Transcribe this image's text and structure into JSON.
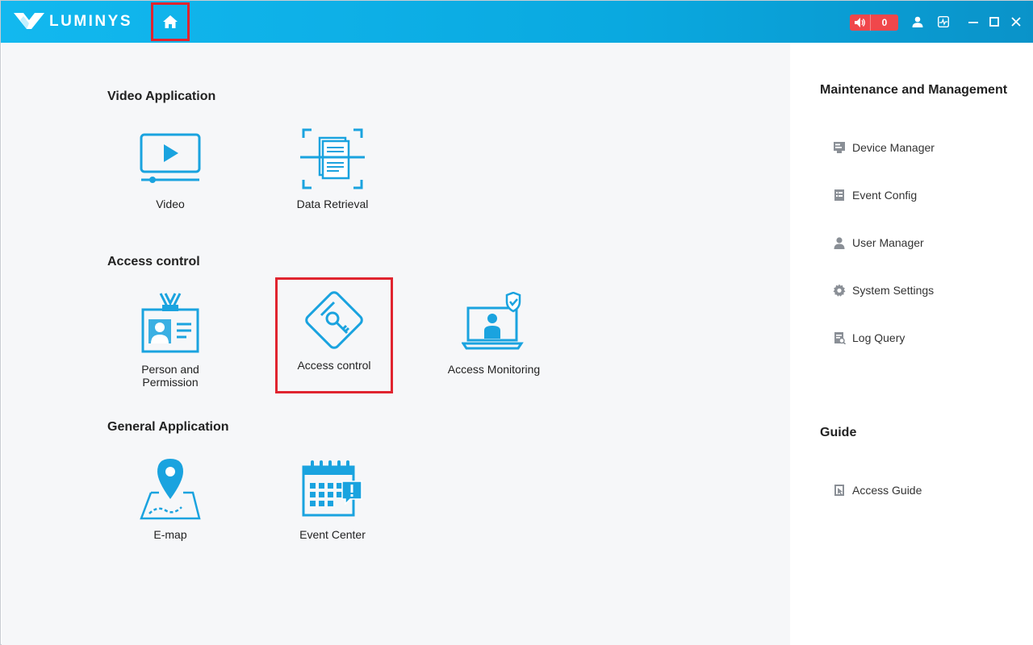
{
  "app": {
    "brand": "LUMINYS"
  },
  "titlebar": {
    "alarm_count": "0"
  },
  "sections": {
    "video_application": {
      "title": "Video Application",
      "items": [
        {
          "label": "Video",
          "icon": "video-player-icon"
        },
        {
          "label": "Data Retrieval",
          "icon": "document-scan-icon"
        }
      ]
    },
    "access_control": {
      "title": "Access control",
      "items": [
        {
          "label": "Person and Permission",
          "icon": "id-badge-icon"
        },
        {
          "label": "Access control",
          "icon": "key-card-icon"
        },
        {
          "label": "Access Monitoring",
          "icon": "monitor-person-shield-icon"
        }
      ]
    },
    "general_application": {
      "title": "General Application",
      "items": [
        {
          "label": "E-map",
          "icon": "map-pin-icon"
        },
        {
          "label": "Event Center",
          "icon": "calendar-alert-icon"
        }
      ]
    }
  },
  "sidebar": {
    "maintenance": {
      "title": "Maintenance and Management",
      "items": [
        {
          "label": "Device Manager",
          "icon": "device-icon"
        },
        {
          "label": "Event Config",
          "icon": "event-config-icon"
        },
        {
          "label": "User Manager",
          "icon": "user-icon"
        },
        {
          "label": "System Settings",
          "icon": "gear-icon"
        },
        {
          "label": "Log Query",
          "icon": "log-search-icon"
        }
      ]
    },
    "guide": {
      "title": "Guide",
      "items": [
        {
          "label": "Access Guide",
          "icon": "guide-icon"
        }
      ]
    }
  },
  "colors": {
    "accent": "#12b8ef",
    "icon": "#1aa3df",
    "highlight": "#e0242f",
    "alarm": "#f0474b"
  }
}
